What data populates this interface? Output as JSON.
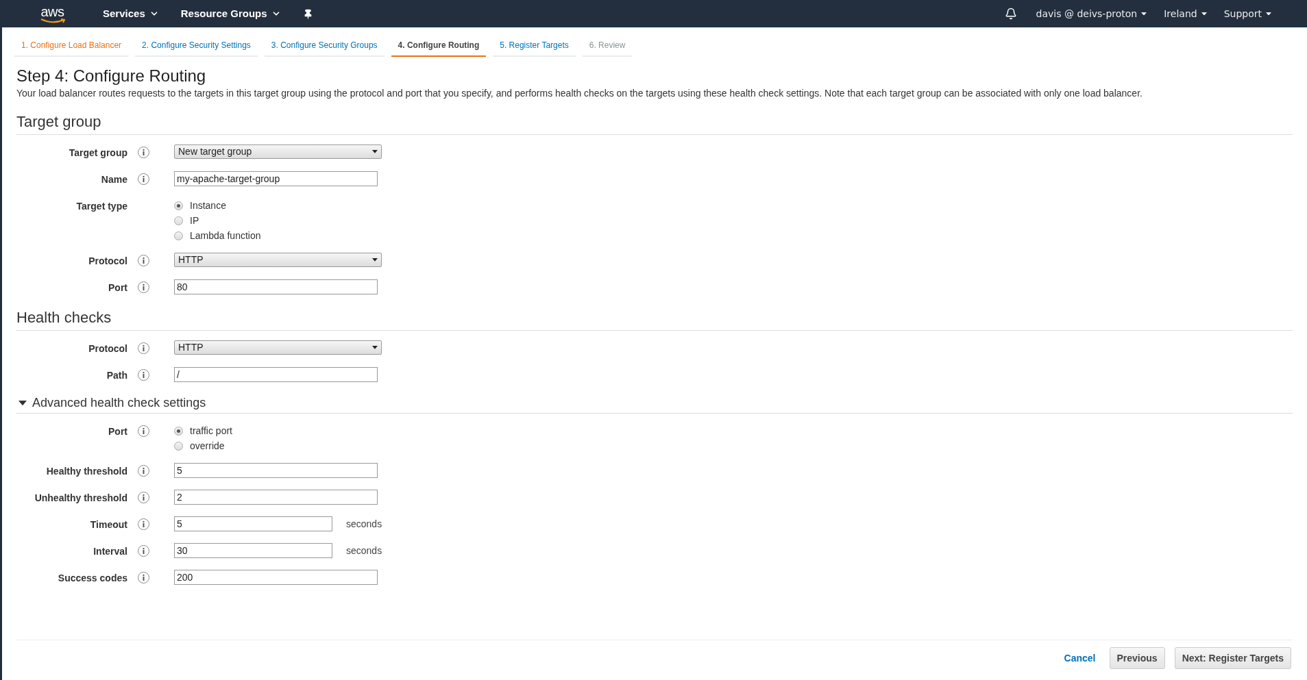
{
  "navbar": {
    "logo": "aws",
    "menus": [
      {
        "label": "Services"
      },
      {
        "label": "Resource Groups"
      }
    ],
    "right_menus": [
      {
        "label": "davis @ deivs-proton"
      },
      {
        "label": "Ireland"
      },
      {
        "label": "Support"
      }
    ]
  },
  "steps": [
    {
      "label": "1. Configure Load Balancer",
      "kind": "visited",
      "selected": false
    },
    {
      "label": "2. Configure Security Settings",
      "kind": "available",
      "selected": false
    },
    {
      "label": "3. Configure Security Groups",
      "kind": "available",
      "selected": false
    },
    {
      "label": "4. Configure Routing",
      "kind": "current",
      "selected": true
    },
    {
      "label": "5. Register Targets",
      "kind": "available",
      "selected": false
    },
    {
      "label": "6. Review",
      "kind": "disabled",
      "selected": false
    }
  ],
  "title": "Step 4: Configure Routing",
  "description": "Your load balancer routes requests to the targets in this target group using the protocol and port that you specify, and performs health checks on the targets using these health check settings. Note that each target group can be associated with only one load balancer.",
  "sections": [
    {
      "heading": "Target group",
      "collapsible": false,
      "fields": [
        {
          "label": "Target group",
          "kind": "select",
          "value": "New target group",
          "info": true
        },
        {
          "label": "Name",
          "kind": "text",
          "value": "my-apache-target-group",
          "info": true
        },
        {
          "label": "Target type",
          "kind": "radio",
          "info": false,
          "options": [
            {
              "label": "Instance",
              "selected": true
            },
            {
              "label": "IP",
              "selected": false
            },
            {
              "label": "Lambda function",
              "selected": false
            }
          ]
        },
        {
          "label": "Protocol",
          "kind": "select",
          "value": "HTTP",
          "info": true
        },
        {
          "label": "Port",
          "kind": "text",
          "value": "80",
          "info": true
        }
      ]
    },
    {
      "heading": "Health checks",
      "collapsible": false,
      "fields": [
        {
          "label": "Protocol",
          "kind": "select",
          "value": "HTTP",
          "info": true
        },
        {
          "label": "Path",
          "kind": "text",
          "value": "/",
          "info": true
        }
      ]
    },
    {
      "heading": "Advanced health check settings",
      "collapsible": true,
      "expanded": true,
      "fields": [
        {
          "label": "Port",
          "kind": "radio",
          "info": true,
          "options": [
            {
              "label": "traffic port",
              "selected": true
            },
            {
              "label": "override",
              "selected": false
            }
          ]
        },
        {
          "label": "Healthy threshold",
          "kind": "text",
          "value": "5",
          "info": true
        },
        {
          "label": "Unhealthy threshold",
          "kind": "text",
          "value": "2",
          "info": true
        },
        {
          "label": "Timeout",
          "kind": "unit",
          "value": "5",
          "unit": "seconds",
          "info": true
        },
        {
          "label": "Interval",
          "kind": "unit",
          "value": "30",
          "unit": "seconds",
          "info": true
        },
        {
          "label": "Success codes",
          "kind": "text",
          "value": "200",
          "info": true
        }
      ]
    }
  ],
  "footer": {
    "cancel": "Cancel",
    "buttons": [
      "Previous",
      "Next: Register Targets"
    ]
  }
}
